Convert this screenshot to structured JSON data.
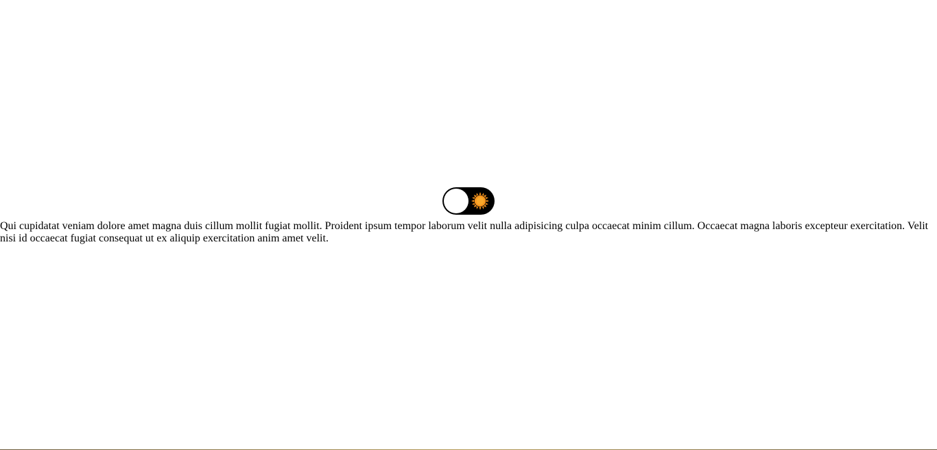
{
  "theme_toggle": {
    "state": "light",
    "knob_color": "#ffffff",
    "track_color": "#000000",
    "icon": "sun-icon",
    "icon_color": "#f7941d"
  },
  "content": {
    "paragraph": "Qui cupidatat veniam dolore amet magna duis cillum mollit fugiat mollit. Proident ipsum tempor laborum velit nulla adipisicing culpa occaecat minim cillum. Occaecat magna laboris excepteur exercitation. Velit nisi id occaecat fugiat consequat ut ex aliquip exercitation anim amet velit."
  }
}
